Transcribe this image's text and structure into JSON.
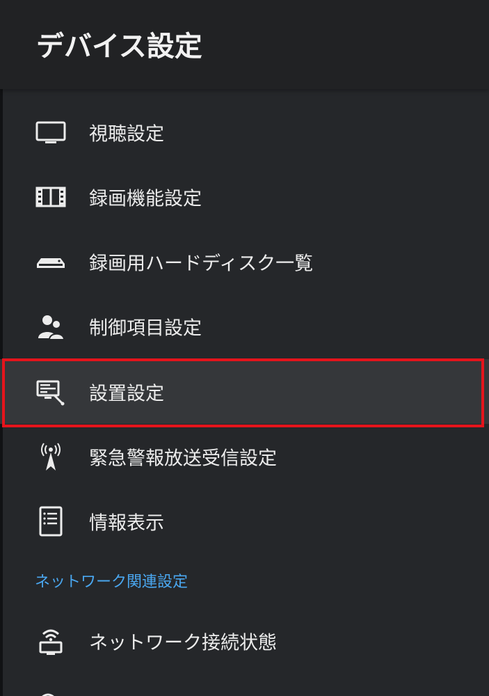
{
  "header": {
    "title": "デバイス設定"
  },
  "menu": {
    "items": [
      {
        "label": "視聴設定",
        "icon": "tv-icon"
      },
      {
        "label": "録画機能設定",
        "icon": "film-icon"
      },
      {
        "label": "録画用ハードディスク一覧",
        "icon": "hard-disk-icon"
      },
      {
        "label": "制御項目設定",
        "icon": "users-icon"
      },
      {
        "label": "設置設定",
        "icon": "setup-icon",
        "selected": true
      },
      {
        "label": "緊急警報放送受信設定",
        "icon": "antenna-icon"
      },
      {
        "label": "情報表示",
        "icon": "info-document-icon"
      }
    ],
    "network_section": {
      "title": "ネットワーク関連設定",
      "items": [
        {
          "label": "ネットワーク接続状態",
          "icon": "network-status-icon"
        }
      ]
    }
  },
  "colors": {
    "background": "#25272a",
    "header": "#212224",
    "selected_row": "#35373a",
    "highlight_frame": "#e5141c",
    "section_accent": "#4aa7f0",
    "text": "#ececec"
  }
}
